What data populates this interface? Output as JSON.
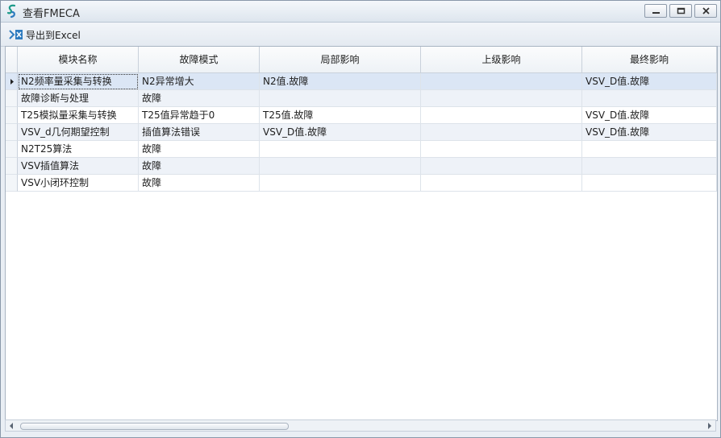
{
  "window": {
    "title": "查看FMECA",
    "icon": "fmeca-app-icon",
    "controls": [
      "minimize-icon",
      "maximize-icon",
      "close-icon"
    ]
  },
  "toolbar": {
    "export_label": "导出到Excel",
    "export_icon": "excel-export-icon"
  },
  "table": {
    "columns": [
      "模块名称",
      "故障模式",
      "局部影响",
      "上级影响",
      "最终影响"
    ],
    "rows": [
      [
        "N2频率量采集与转换",
        "N2异常增大",
        "N2值.故障",
        "",
        "VSV_D值.故障"
      ],
      [
        "故障诊断与处理",
        "故障",
        "",
        "",
        ""
      ],
      [
        "T25模拟量采集与转换",
        "T25值异常趋于0",
        "T25值.故障",
        "",
        "VSV_D值.故障"
      ],
      [
        "VSV_d几何期望控制",
        "插值算法错误",
        "VSV_D值.故障",
        "",
        "VSV_D值.故障"
      ],
      [
        "N2T25算法",
        "故障",
        "",
        "",
        ""
      ],
      [
        "VSV插值算法",
        "故障",
        "",
        "",
        ""
      ],
      [
        "VSV小闭环控制",
        "故障",
        "",
        "",
        ""
      ]
    ],
    "selected_row": 0
  },
  "colors": {
    "accent": "#2e7bbf",
    "selected_row": "#dbe6f5",
    "alt_row": "#eef2f8"
  }
}
